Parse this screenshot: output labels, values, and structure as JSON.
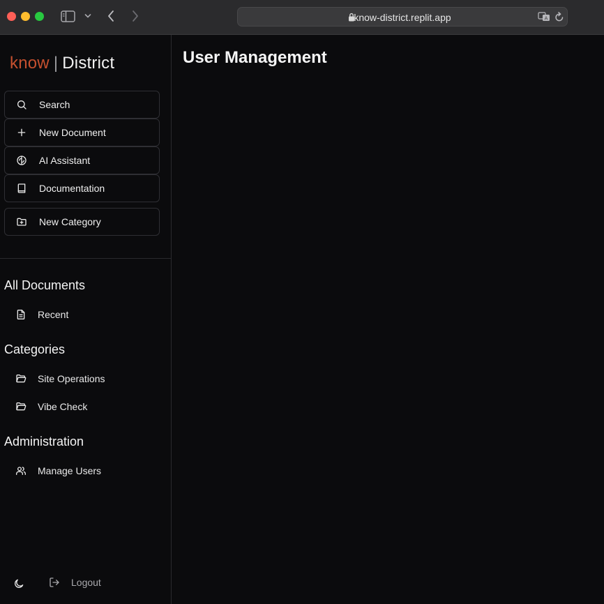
{
  "browser": {
    "url": "know-district.replit.app"
  },
  "brand": {
    "part1": "know",
    "separator": "|",
    "part2": "District"
  },
  "actions": [
    {
      "label": "Search",
      "icon": "search-icon"
    },
    {
      "label": "New Document",
      "icon": "plus-icon"
    },
    {
      "label": "AI Assistant",
      "icon": "brain-icon"
    },
    {
      "label": "Documentation",
      "icon": "book-icon"
    },
    {
      "label": "New Category",
      "icon": "folder-plus-icon"
    }
  ],
  "sections": {
    "all_documents": {
      "title": "All Documents",
      "items": [
        {
          "label": "Recent",
          "icon": "file-text-icon"
        }
      ]
    },
    "categories": {
      "title": "Categories",
      "items": [
        {
          "label": "Site Operations",
          "icon": "folder-open-icon"
        },
        {
          "label": "Vibe Check",
          "icon": "folder-open-icon"
        }
      ]
    },
    "administration": {
      "title": "Administration",
      "items": [
        {
          "label": "Manage Users",
          "icon": "users-icon"
        }
      ]
    }
  },
  "footer": {
    "theme_icon": "moon-icon",
    "logout_label": "Logout"
  },
  "main": {
    "title": "User Management"
  },
  "colors": {
    "brand_accent": "#c5502f",
    "background": "#0b0b0d",
    "border": "#2f2f34"
  }
}
